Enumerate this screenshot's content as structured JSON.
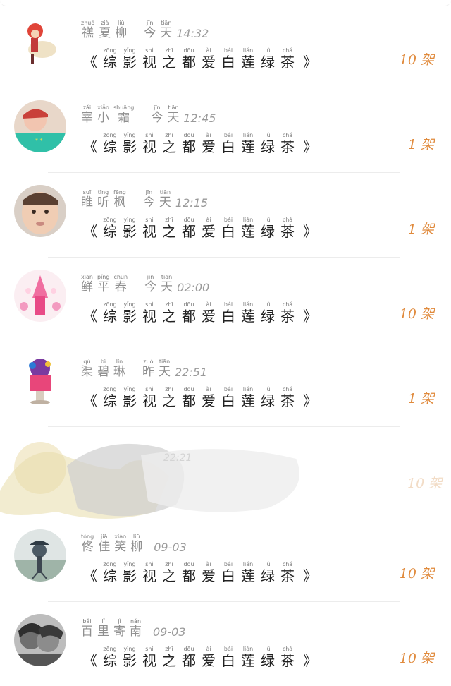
{
  "title_tokens": [
    {
      "py": "zōng",
      "hz": "综"
    },
    {
      "py": "yǐng",
      "hz": "影"
    },
    {
      "py": "shì",
      "hz": "视"
    },
    {
      "py": "zhī",
      "hz": "之"
    },
    {
      "py": "dōu",
      "hz": "都"
    },
    {
      "py": "ài",
      "hz": "爱"
    },
    {
      "py": "bái",
      "hz": "白"
    },
    {
      "py": "lián",
      "hz": "莲"
    },
    {
      "py": "lǜ",
      "hz": "绿"
    },
    {
      "py": "chá",
      "hz": "茶"
    }
  ],
  "title_left": "《",
  "title_right": "》",
  "rows": [
    {
      "name": [
        {
          "py": "zhuó",
          "hz": "禚"
        },
        {
          "py": "zià",
          "hz": "夏"
        },
        {
          "py": "liǔ",
          "hz": "柳"
        }
      ],
      "day": [
        {
          "py": "jīn",
          "hz": "今"
        },
        {
          "py": "tiān",
          "hz": "天"
        }
      ],
      "time": "14:32",
      "count": "10 架"
    },
    {
      "name": [
        {
          "py": "zǎi",
          "hz": "宰"
        },
        {
          "py": "xiǎo",
          "hz": "小"
        },
        {
          "py": "shuāng",
          "hz": "霜"
        }
      ],
      "day": [
        {
          "py": "jīn",
          "hz": "今"
        },
        {
          "py": "tiān",
          "hz": "天"
        }
      ],
      "time": "12:45",
      "count": "1 架"
    },
    {
      "name": [
        {
          "py": "suī",
          "hz": "睢"
        },
        {
          "py": "tīng",
          "hz": "听"
        },
        {
          "py": "fēng",
          "hz": "枫"
        }
      ],
      "day": [
        {
          "py": "jīn",
          "hz": "今"
        },
        {
          "py": "tiān",
          "hz": "天"
        }
      ],
      "time": "12:15",
      "count": "1 架"
    },
    {
      "name": [
        {
          "py": "xiān",
          "hz": "鲜"
        },
        {
          "py": "píng",
          "hz": "平"
        },
        {
          "py": "chūn",
          "hz": "春"
        }
      ],
      "day": [
        {
          "py": "jīn",
          "hz": "今"
        },
        {
          "py": "tiān",
          "hz": "天"
        }
      ],
      "time": "02:00",
      "count": "10 架"
    },
    {
      "name": [
        {
          "py": "qú",
          "hz": "渠"
        },
        {
          "py": "bì",
          "hz": "碧"
        },
        {
          "py": "lín",
          "hz": "琳"
        }
      ],
      "day": [
        {
          "py": "zuó",
          "hz": "昨"
        },
        {
          "py": "tiān",
          "hz": "天"
        }
      ],
      "time": "22:51",
      "count": "1 架"
    },
    {
      "name": [
        {
          "py": "tóng",
          "hz": "佟"
        },
        {
          "py": "jiā",
          "hz": "佳"
        },
        {
          "py": "xiào",
          "hz": "笑"
        },
        {
          "py": "liǔ",
          "hz": "柳"
        }
      ],
      "day": [],
      "time": "09-03",
      "count": "10 架"
    },
    {
      "name": [
        {
          "py": "bǎi",
          "hz": "百"
        },
        {
          "py": "lǐ",
          "hz": "里"
        },
        {
          "py": "jì",
          "hz": "寄"
        },
        {
          "py": "nán",
          "hz": "南"
        }
      ],
      "day": [],
      "time": "09-03",
      "count": "10 架"
    }
  ],
  "faded_row": {
    "time": "22:21",
    "count": "10 架"
  },
  "colors": {
    "accent": "#e08a3c",
    "name_text": "#8f8f8f",
    "title_text": "#222222",
    "separator": "#ececec"
  }
}
